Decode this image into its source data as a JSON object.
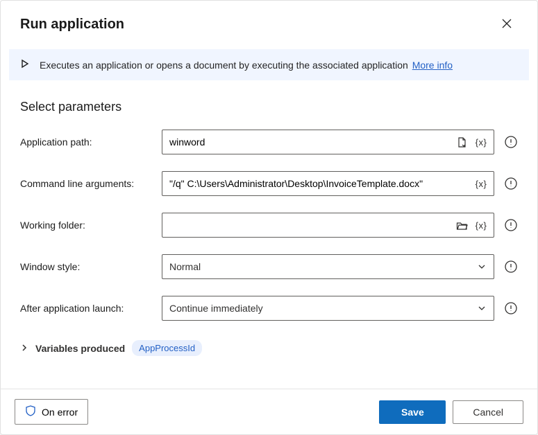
{
  "dialog": {
    "title": "Run application",
    "info_text": "Executes an application or opens a document by executing the associated application",
    "more_info": "More info"
  },
  "section_title": "Select parameters",
  "fields": {
    "app_path": {
      "label": "Application path:",
      "value": "winword"
    },
    "cmd_args": {
      "label": "Command line arguments:",
      "value": "\"/q\" C:\\Users\\Administrator\\Desktop\\InvoiceTemplate.docx\""
    },
    "work_folder": {
      "label": "Working folder:",
      "value": ""
    },
    "window_style": {
      "label": "Window style:",
      "value": "Normal"
    },
    "after_launch": {
      "label": "After application launch:",
      "value": "Continue immediately"
    }
  },
  "variables": {
    "label": "Variables produced",
    "chip": "AppProcessId"
  },
  "footer": {
    "on_error": "On error",
    "save": "Save",
    "cancel": "Cancel"
  },
  "glyphs": {
    "var_x": "{x}"
  }
}
